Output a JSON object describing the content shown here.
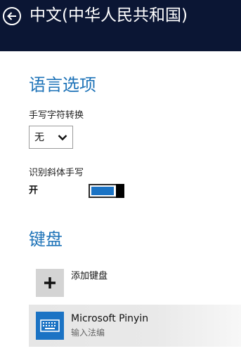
{
  "header": {
    "title": "中文(中华人民共和国)",
    "back_icon": "back-arrow-icon",
    "background": "#0b1634"
  },
  "language_options": {
    "title": "语言选项",
    "handwriting_conversion": {
      "label": "手写字符转换",
      "selected": "无",
      "icon": "chevron-down-icon"
    },
    "italic_handwriting": {
      "label": "识别斜体手写",
      "state_label": "开",
      "on": true
    }
  },
  "keyboards": {
    "title": "键盘",
    "add_keyboard": {
      "label": "添加键盘",
      "icon": "plus-icon"
    },
    "items": [
      {
        "name": "Microsoft Pinyin",
        "subtitle": "输入法编",
        "icon": "keyboard-icon"
      }
    ]
  },
  "colors": {
    "accent": "#1e73b8",
    "toggle_on": "#1b73c4",
    "tile_blue": "#1b73c4",
    "tile_gray": "#d4d4d4"
  }
}
